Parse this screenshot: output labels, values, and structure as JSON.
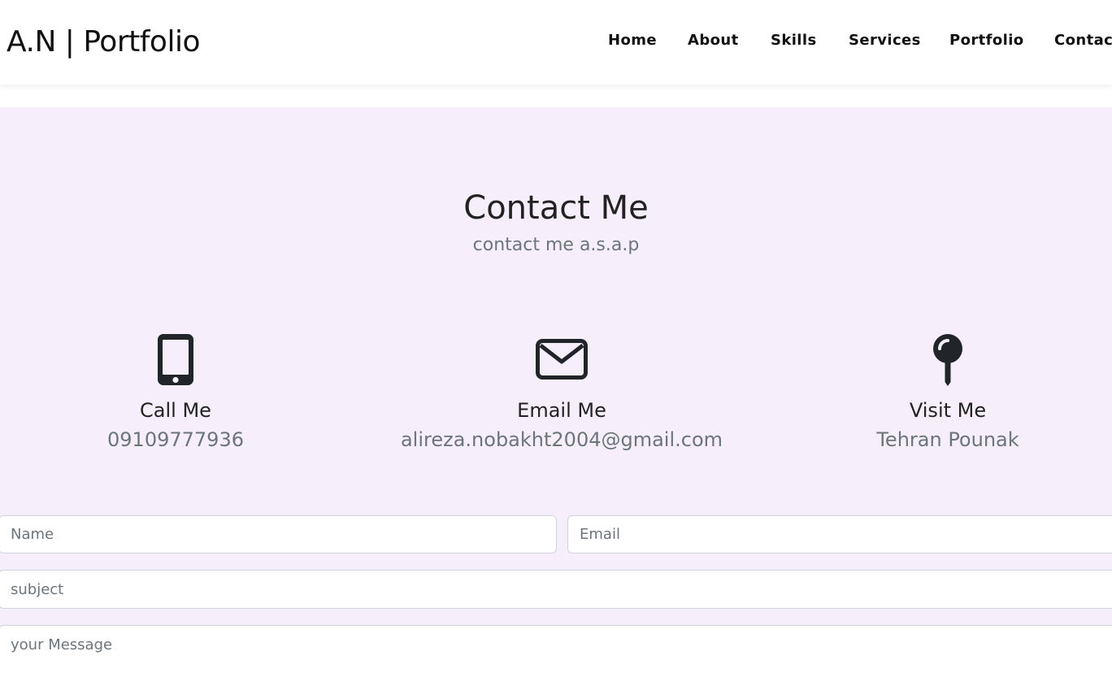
{
  "navbar": {
    "brand": "A.N | Portfolio",
    "links": [
      {
        "label": "Home"
      },
      {
        "label": "About"
      },
      {
        "label": "Skills"
      },
      {
        "label": "Services"
      },
      {
        "label": "Portfolio"
      },
      {
        "label": "Contact"
      }
    ]
  },
  "contact": {
    "title": "Contact Me",
    "subtitle": "contact me a.s.a.p",
    "info": [
      {
        "icon": "mobile-phone-icon",
        "title": "Call Me",
        "value": "09109777936"
      },
      {
        "icon": "envelope-icon",
        "title": "Email Me",
        "value": "alireza.nobakht2004@gmail.com"
      },
      {
        "icon": "map-pin-icon",
        "title": "Visit Me",
        "value": "Tehran Pounak"
      }
    ],
    "form": {
      "name_placeholder": "Name",
      "email_placeholder": "Email",
      "subject_placeholder": "subject",
      "message_placeholder": "your Message"
    }
  },
  "colors": {
    "section_bg": "#f6eefa",
    "icon": "#212529",
    "muted_text": "#6c757d"
  }
}
